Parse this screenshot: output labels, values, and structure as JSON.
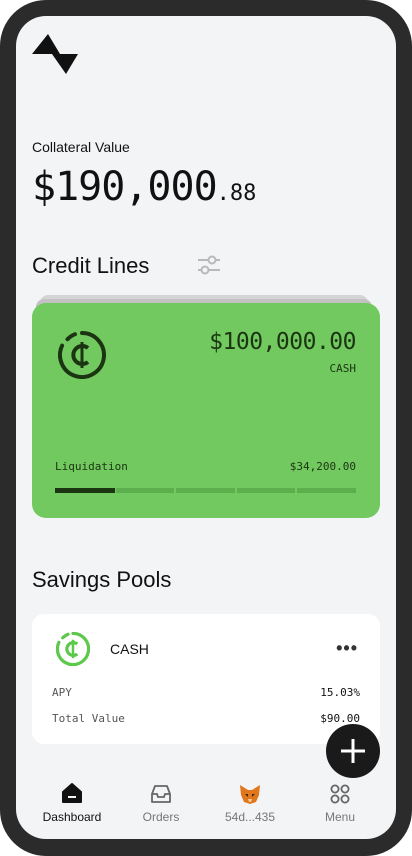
{
  "collateral": {
    "label": "Collateral Value",
    "whole": "$190,000",
    "cents": ".88"
  },
  "credit_lines": {
    "title": "Credit Lines",
    "card": {
      "amount": "$100,000.00",
      "currency": "CASH",
      "liquidation_label": "Liquidation",
      "liquidation_value": "$34,200.00",
      "progress": 0.2
    }
  },
  "savings": {
    "title": "Savings Pools",
    "pool": {
      "name": "CASH",
      "rows": [
        {
          "label": "APY",
          "value": "15.03%"
        },
        {
          "label": "Total Value",
          "value": "$90.00"
        }
      ]
    }
  },
  "nav": {
    "tabs": [
      {
        "label": "Dashboard",
        "icon": "home-icon"
      },
      {
        "label": "Orders",
        "icon": "inbox-icon"
      },
      {
        "label": "54d...435",
        "icon": "fox-icon"
      },
      {
        "label": "Menu",
        "icon": "grid-icon"
      }
    ]
  },
  "colors": {
    "card_green": "#72c95f",
    "icon_green": "#5cc94a",
    "dark": "#1a1a1a"
  }
}
